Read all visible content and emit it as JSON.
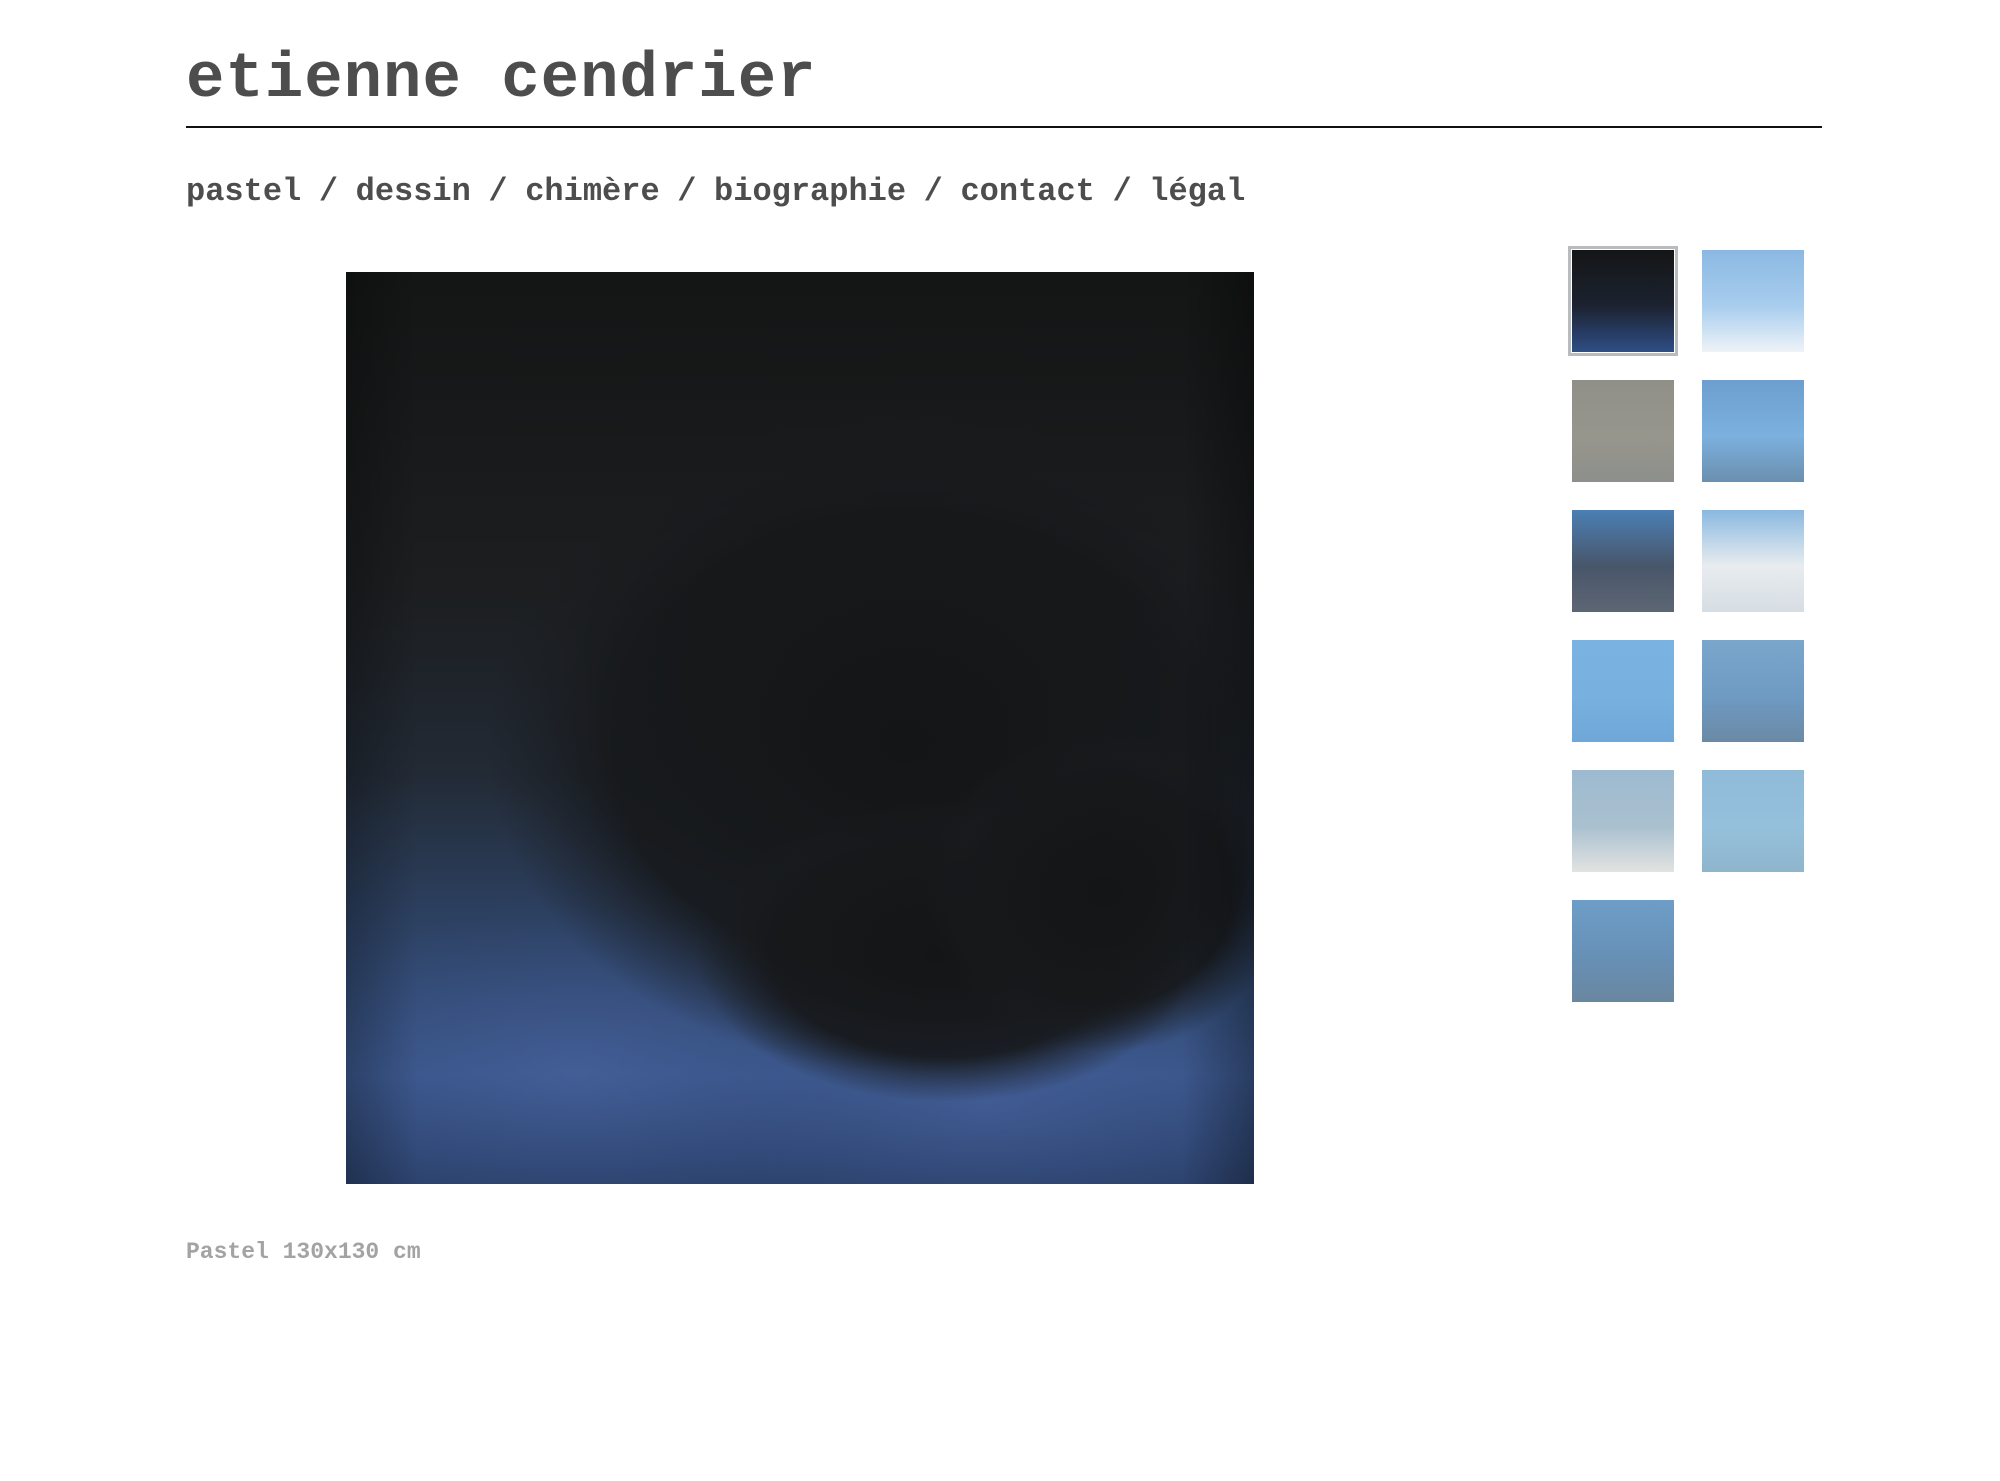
{
  "site": {
    "title": "etienne cendrier"
  },
  "nav": {
    "items": [
      {
        "label": "pastel"
      },
      {
        "label": "dessin"
      },
      {
        "label": "chimère"
      },
      {
        "label": "biographie"
      },
      {
        "label": "contact"
      },
      {
        "label": "légal"
      }
    ],
    "separator": "/"
  },
  "artwork": {
    "caption": "Pastel 130x130 cm"
  },
  "thumbnails": [
    {
      "id": "thumb-1",
      "selected": true,
      "colors": [
        "#141516",
        "#1c2230",
        "#2f4e86"
      ]
    },
    {
      "id": "thumb-2",
      "selected": false,
      "colors": [
        "#8bb8e2",
        "#a8cdee",
        "#eef3f7"
      ]
    },
    {
      "id": "thumb-3",
      "selected": false,
      "colors": [
        "#909088",
        "#97968d",
        "#8d8f8b"
      ]
    },
    {
      "id": "thumb-4",
      "selected": false,
      "colors": [
        "#6c9fcf",
        "#7cb0de",
        "#6b8fae"
      ]
    },
    {
      "id": "thumb-5",
      "selected": false,
      "colors": [
        "#4b7fb4",
        "#48566a",
        "#5d6673"
      ]
    },
    {
      "id": "thumb-6",
      "selected": false,
      "colors": [
        "#8ab8e0",
        "#e8ecef",
        "#d6dde3"
      ]
    },
    {
      "id": "thumb-7",
      "selected": false,
      "colors": [
        "#7ab2e2",
        "#78b0df",
        "#6fa8d8"
      ]
    },
    {
      "id": "thumb-8",
      "selected": false,
      "colors": [
        "#7aa6cc",
        "#6f9ac2",
        "#6a8aa6"
      ]
    },
    {
      "id": "thumb-9",
      "selected": false,
      "colors": [
        "#9dbad0",
        "#a9c0cf",
        "#e2e3e1"
      ]
    },
    {
      "id": "thumb-10",
      "selected": false,
      "colors": [
        "#8fbbd9",
        "#95c0dc",
        "#8fb5cc"
      ]
    },
    {
      "id": "thumb-11",
      "selected": false,
      "colors": [
        "#6d9ec7",
        "#6790b6",
        "#6a879f"
      ]
    }
  ],
  "colors": {
    "text": "#4d4d4d",
    "caption": "#a3a3a3",
    "rule": "#111111",
    "selected_border": "#b9bcbf"
  }
}
